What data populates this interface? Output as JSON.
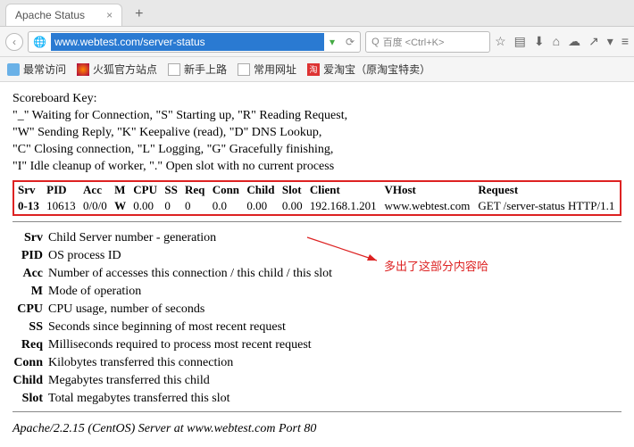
{
  "tab": {
    "title": "Apache Status",
    "close": "×",
    "new": "+"
  },
  "url": "www.webtest.com/server-status",
  "search_placeholder": "百度 <Ctrl+K>",
  "bookmarks": {
    "b1": "最常访问",
    "b2": "火狐官方站点",
    "b3": "新手上路",
    "b4": "常用网址",
    "b5": "爱淘宝（原淘宝特卖）"
  },
  "scoreboard": {
    "title": "Scoreboard Key:",
    "l1": "\"_\" Waiting for Connection, \"S\" Starting up, \"R\" Reading Request,",
    "l2": "\"W\" Sending Reply, \"K\" Keepalive (read), \"D\" DNS Lookup,",
    "l3": "\"C\" Closing connection, \"L\" Logging, \"G\" Gracefully finishing,",
    "l4": "\"I\" Idle cleanup of worker, \".\" Open slot with no current process"
  },
  "table": {
    "headers": {
      "srv": "Srv",
      "pid": "PID",
      "acc": "Acc",
      "m": "M",
      "cpu": "CPU",
      "ss": "SS",
      "req": "Req",
      "conn": "Conn",
      "child": "Child",
      "slot": "Slot",
      "client": "Client",
      "vhost": "VHost",
      "request": "Request"
    },
    "row": {
      "srv": "0-13",
      "pid": "10613",
      "acc": "0/0/0",
      "m": "W",
      "cpu": "0.00",
      "ss": "0",
      "req": "0",
      "conn": "0.0",
      "child": "0.00",
      "slot": "0.00",
      "client": "192.168.1.201",
      "vhost": "www.webtest.com",
      "request": "GET /server-status HTTP/1.1"
    }
  },
  "defs": {
    "srv": {
      "t": "Srv",
      "d": "Child Server number - generation"
    },
    "pid": {
      "t": "PID",
      "d": "OS process ID"
    },
    "acc": {
      "t": "Acc",
      "d": "Number of accesses this connection / this child / this slot"
    },
    "m": {
      "t": "M",
      "d": "Mode of operation"
    },
    "cpu": {
      "t": "CPU",
      "d": "CPU usage, number of seconds"
    },
    "ss": {
      "t": "SS",
      "d": "Seconds since beginning of most recent request"
    },
    "req": {
      "t": "Req",
      "d": "Milliseconds required to process most recent request"
    },
    "conn": {
      "t": "Conn",
      "d": "Kilobytes transferred this connection"
    },
    "child": {
      "t": "Child",
      "d": "Megabytes transferred this child"
    },
    "slot": {
      "t": "Slot",
      "d": "Total megabytes transferred this slot"
    }
  },
  "annotation": "多出了这部分内容哈",
  "footer": "Apache/2.2.15 (CentOS) Server at www.webtest.com Port 80"
}
